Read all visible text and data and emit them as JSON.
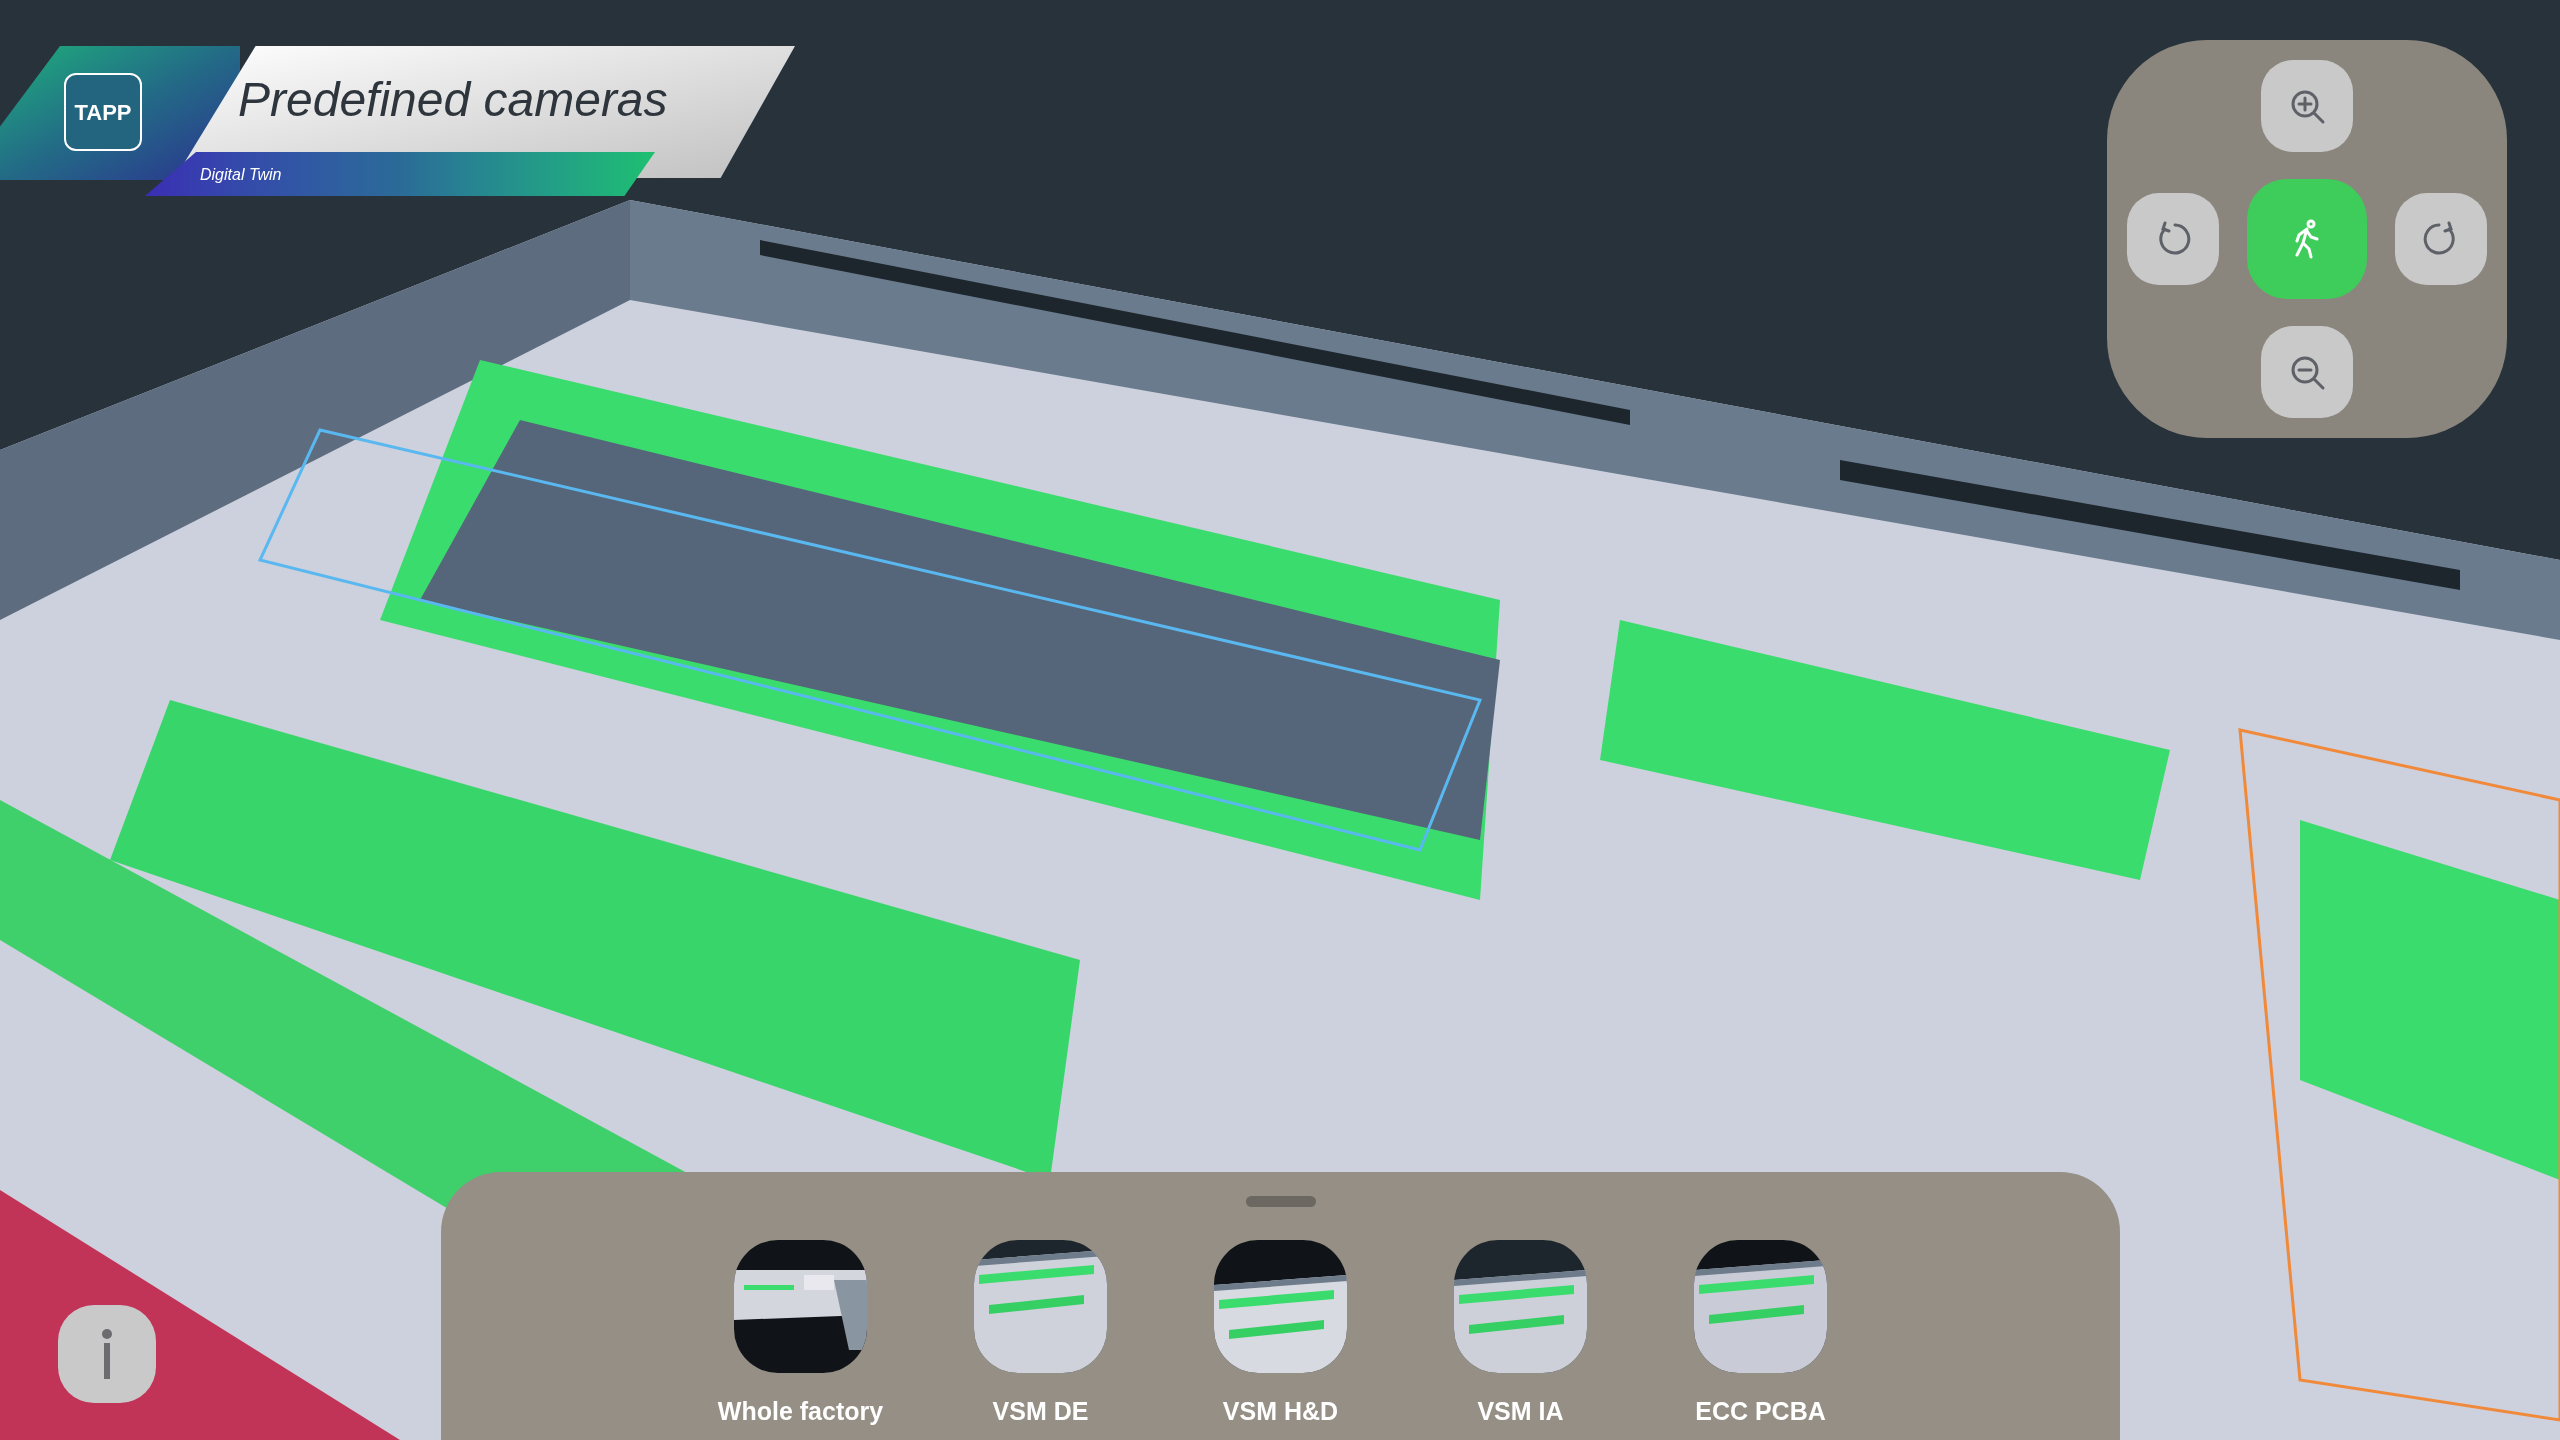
{
  "header": {
    "logo_text": "TAPP",
    "title": "Predefined cameras",
    "subtitle": "Digital Twin"
  },
  "camera_controls": [
    {
      "kind": "zoom_in",
      "selected": false
    },
    {
      "kind": "rotate_left",
      "selected": false
    },
    {
      "kind": "walk",
      "selected": true
    },
    {
      "kind": "rotate_right",
      "selected": false
    },
    {
      "kind": "zoom_out",
      "selected": false
    }
  ],
  "presets": [
    {
      "label": "Whole factory",
      "kind": "picture"
    },
    {
      "label": "VSM DE",
      "kind": "picture"
    },
    {
      "label": "VSM H&D",
      "kind": "picture"
    },
    {
      "label": "VSM IA",
      "kind": "picture"
    },
    {
      "label": "ECC PCBA",
      "kind": "picture"
    }
  ]
}
